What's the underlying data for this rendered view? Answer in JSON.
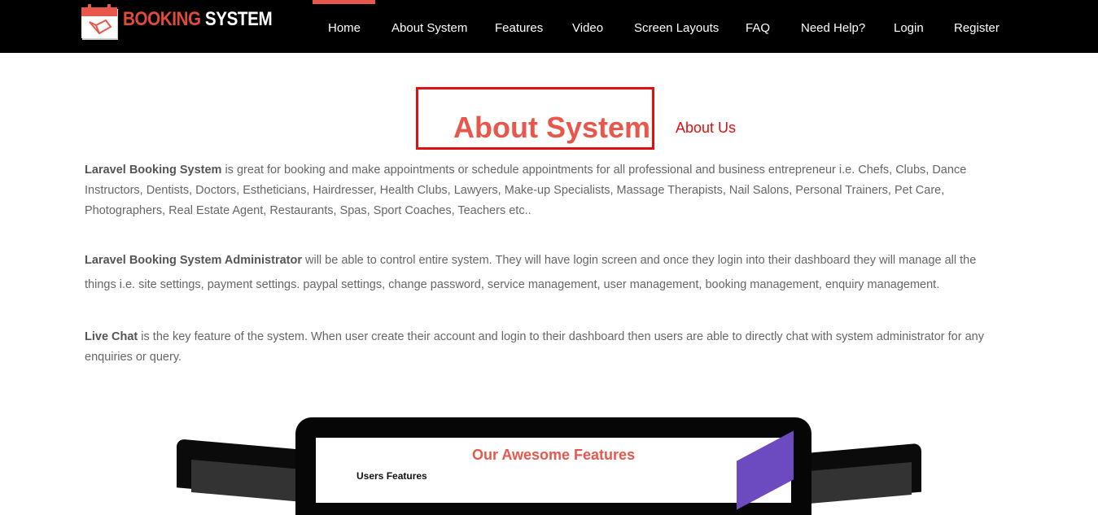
{
  "brand": {
    "word1": "BOOKING",
    "word2": "SYSTEM"
  },
  "nav": {
    "items": [
      "Home",
      "About System",
      "Features",
      "Video",
      "Screen Layouts",
      "FAQ",
      "Need Help?",
      "Login",
      "Register"
    ],
    "active": "Home"
  },
  "section": {
    "title": "About System",
    "subtitle": "About Us"
  },
  "paragraphs": [
    {
      "bold": "Laravel Booking System",
      "text": " is great for booking and make appointments or schedule appointments for all professional and business entrepreneur i.e. Chefs, Clubs, Dance Instructors, Dentists, Doctors, Estheticians, Hairdresser, Health Clubs, Lawyers, Make-up Specialists, Massage Therapists, Nail Salons, Personal Trainers, Pet Care, Photographers, Real Estate Agent, Restaurants, Spas, Sport Coaches, Teachers etc.."
    },
    {
      "bold": "Laravel Booking System Administrator",
      "text": " will be able to control entire system. They will have login screen and once they login into their dashboard they will manage all the things i.e. site settings, payment settings. paypal settings, change password, service management, user management, booking management, enquiry management."
    },
    {
      "bold": "Live Chat",
      "text": " is the key feature of the system. When user create their account and login to their dashboard then users are able to directly chat with system administrator for any enquiries or query."
    }
  ],
  "showcase": {
    "heading": "Our Awesome Features",
    "subheading": "Users Features"
  },
  "colors": {
    "accent": "#e8574b",
    "highlight_border": "#e01010",
    "navbar": "#000000",
    "text": "#666666"
  }
}
